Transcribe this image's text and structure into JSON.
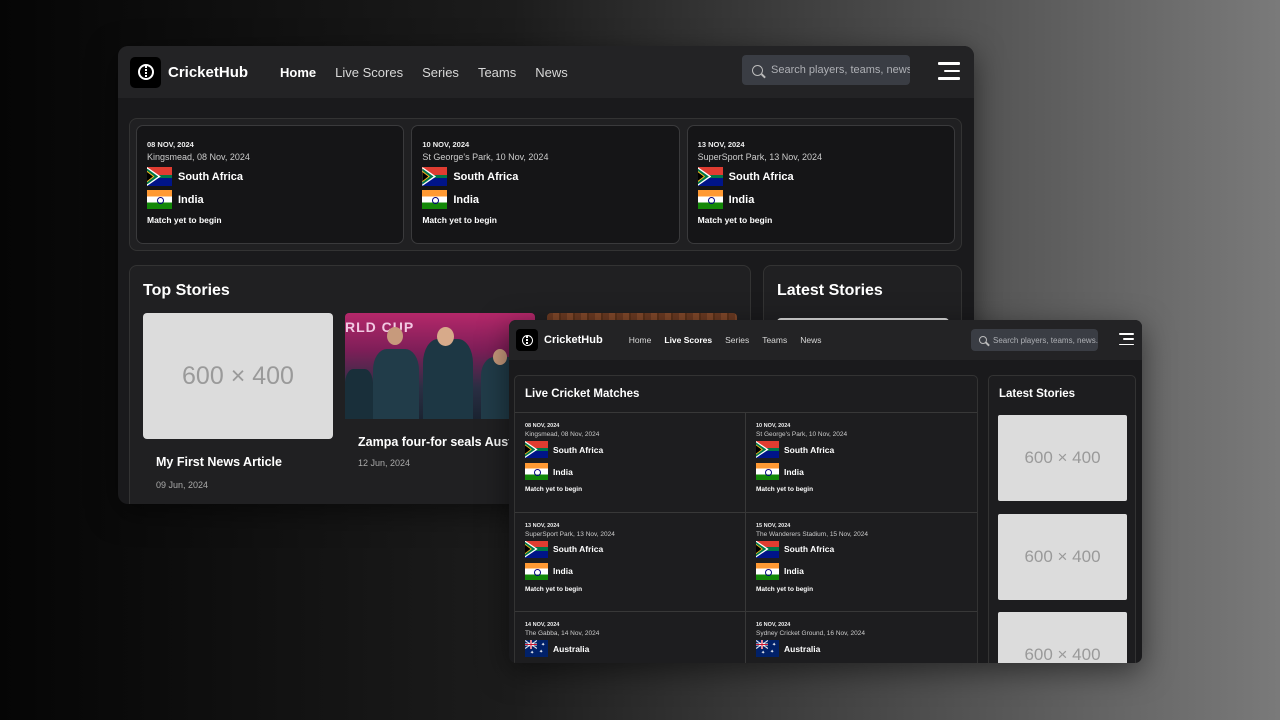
{
  "brand": "CricketHub",
  "nav": {
    "items": [
      "Home",
      "Live Scores",
      "Series",
      "Teams",
      "News"
    ]
  },
  "search": {
    "placeholder": "Search players, teams, news..."
  },
  "colors": {
    "background": "#1a1a1c",
    "nav_bg": "#232325",
    "search_bg": "#3a3d44",
    "placeholder_bg": "#dcdcdc"
  },
  "icons": {
    "logo": "cricket-ball-icon",
    "search": "search-icon",
    "menu": "hamburger-menu-icon"
  },
  "matches": [
    {
      "date": "08 NOV, 2024",
      "venue": "Kingsmead, 08 Nov, 2024",
      "team1": "South Africa",
      "team1_flag": "za",
      "team2": "India",
      "team2_flag": "in",
      "status": "Match yet to begin"
    },
    {
      "date": "10 NOV, 2024",
      "venue": "St George's Park, 10 Nov, 2024",
      "team1": "South Africa",
      "team1_flag": "za",
      "team2": "India",
      "team2_flag": "in",
      "status": "Match yet to begin"
    },
    {
      "date": "13 NOV, 2024",
      "venue": "SuperSport Park, 13 Nov, 2024",
      "team1": "South Africa",
      "team1_flag": "za",
      "team2": "India",
      "team2_flag": "in",
      "status": "Match yet to begin"
    },
    {
      "date": "15 NOV, 2024",
      "venue": "The Wanderers Stadium, 15 Nov, 2024",
      "team1": "South Africa",
      "team1_flag": "za",
      "team2": "India",
      "team2_flag": "in",
      "status": "Match yet to begin"
    },
    {
      "date": "14 NOV, 2024",
      "venue": "The Gabba, 14 Nov, 2024",
      "team1": "Australia",
      "team1_flag": "au"
    },
    {
      "date": "16 NOV, 2024",
      "venue": "Sydney Cricket Ground, 16 Nov, 2024",
      "team1": "Australia",
      "team1_flag": "au"
    }
  ],
  "top_stories": {
    "title": "Top Stories",
    "items": [
      {
        "image": "600 × 400",
        "title": "My First News Article",
        "date": "09 Jun, 2024"
      },
      {
        "image_banner": "RLD CUP",
        "title": "Zampa four-for seals Australia's Super Eight spot",
        "date": "12 Jun, 2024"
      },
      {
        "title": ""
      }
    ]
  },
  "latest_stories": {
    "title": "Latest Stories",
    "placeholder": "600 × 400"
  },
  "live_matches": {
    "title": "Live Cricket Matches"
  }
}
